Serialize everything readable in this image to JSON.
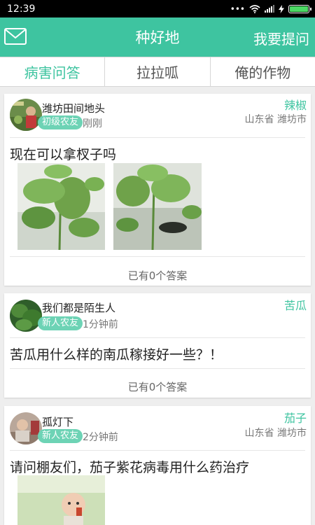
{
  "status_bar": {
    "time": "12:39"
  },
  "app_bar": {
    "title": "种好地",
    "ask_label": "我要提问"
  },
  "tabs": [
    {
      "label": "病害问答",
      "active": true
    },
    {
      "label": "拉拉呱",
      "active": false
    },
    {
      "label": "俺的作物",
      "active": false
    }
  ],
  "colors": {
    "accent": "#3ec4a0",
    "badge": "#6dd3b5"
  },
  "posts": [
    {
      "user": "潍坊田间地头",
      "level": "初级农友",
      "time": "刚刚",
      "crop": "辣椒",
      "location": "山东省 潍坊市",
      "question": "现在可以拿杈子吗",
      "answers": "已有0个答案"
    },
    {
      "user": "我们都是陌生人",
      "level": "新人农友",
      "time": "1分钟前",
      "crop": "苦瓜",
      "location": "",
      "question": "苦瓜用什么样的南瓜稼接好一些？！",
      "answers": "已有0个答案"
    },
    {
      "user": "孤灯下",
      "level": "新人农友",
      "time": "2分钟前",
      "crop": "茄子",
      "location": "山东省 潍坊市",
      "question": "请问棚友们，茄子紫花病毒用什么药治疗"
    }
  ]
}
